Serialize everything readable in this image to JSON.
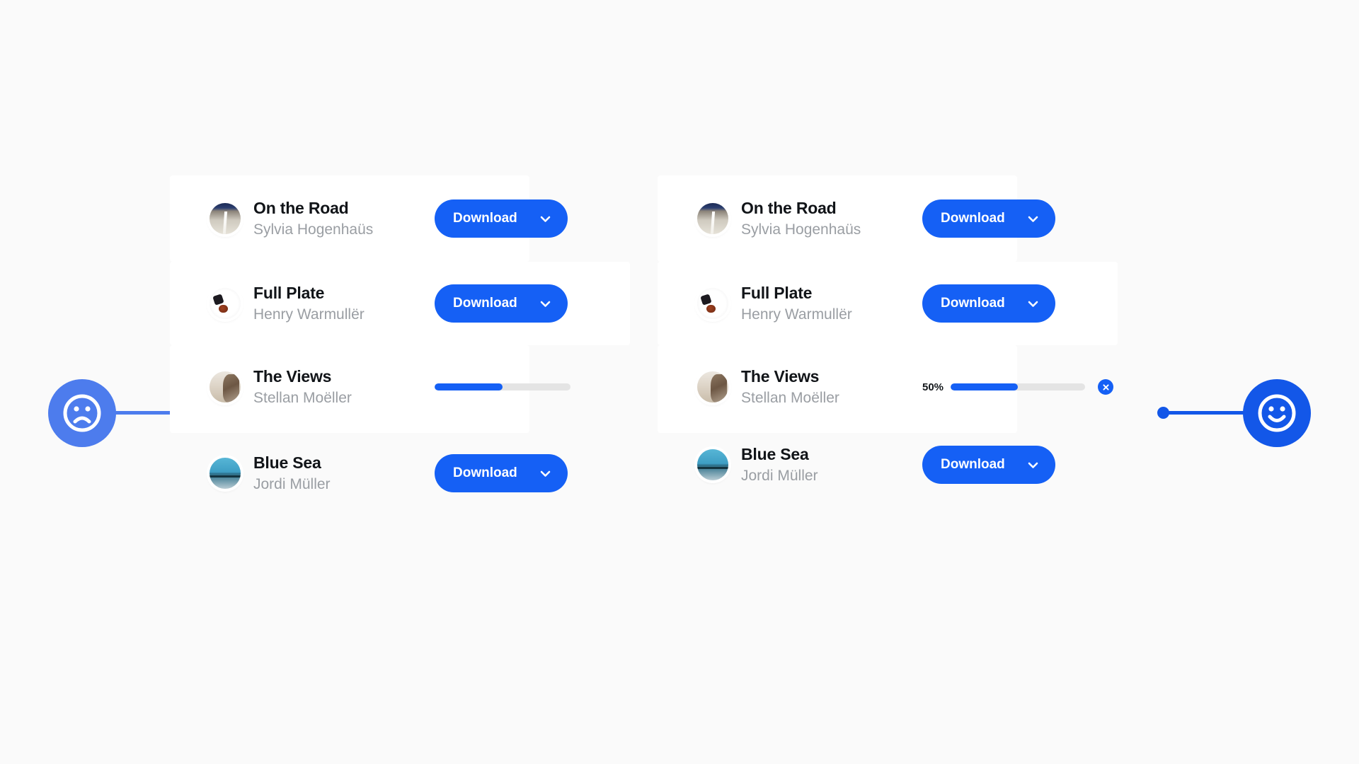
{
  "background_color": "#fafafa",
  "accent_color": "#1560f5",
  "accent_soft_color": "#4d7ced",
  "endcaps": {
    "left": {
      "icon": "sad-face-icon",
      "state_label": "sad",
      "color": "#4d7ced"
    },
    "right": {
      "icon": "happy-face-icon",
      "state_label": "happy",
      "color": "#1357e8"
    }
  },
  "panels": [
    {
      "id": "before",
      "rows": [
        {
          "title": "On the Road",
          "author": "Sylvia Hogenhaüs",
          "thumb": "road-thumbnail",
          "action": "download",
          "button_label": "Download",
          "chevron_icon": "chevron-down-icon"
        },
        {
          "title": "Full Plate",
          "author": "Henry Warmullër",
          "thumb": "plate-thumbnail",
          "action": "download",
          "button_label": "Download",
          "chevron_icon": "chevron-down-icon"
        },
        {
          "title": "The Views",
          "author": "Stellan Moëller",
          "thumb": "views-thumbnail",
          "action": "progress",
          "progress_percent": 50,
          "progress_label": "",
          "has_cancel": false
        },
        {
          "title": "Blue Sea",
          "author": "Jordi Müller",
          "thumb": "sea-thumbnail",
          "action": "download",
          "button_label": "Download",
          "chevron_icon": "chevron-down-icon"
        }
      ]
    },
    {
      "id": "after",
      "rows": [
        {
          "title": "On the Road",
          "author": "Sylvia Hogenhaüs",
          "thumb": "road-thumbnail",
          "action": "download",
          "button_label": "Download",
          "chevron_icon": "chevron-down-icon"
        },
        {
          "title": "Full Plate",
          "author": "Henry Warmullër",
          "thumb": "plate-thumbnail",
          "action": "download",
          "button_label": "Download",
          "chevron_icon": "chevron-down-icon"
        },
        {
          "title": "The Views",
          "author": "Stellan Moëller",
          "thumb": "views-thumbnail",
          "action": "progress",
          "progress_percent": 50,
          "progress_label": "50%",
          "has_cancel": true,
          "cancel_icon": "close-icon"
        },
        {
          "title": "Blue Sea",
          "author": "Jordi Müller",
          "thumb": "sea-thumbnail",
          "action": "download",
          "button_label": "Download",
          "chevron_icon": "chevron-down-icon"
        }
      ]
    }
  ]
}
